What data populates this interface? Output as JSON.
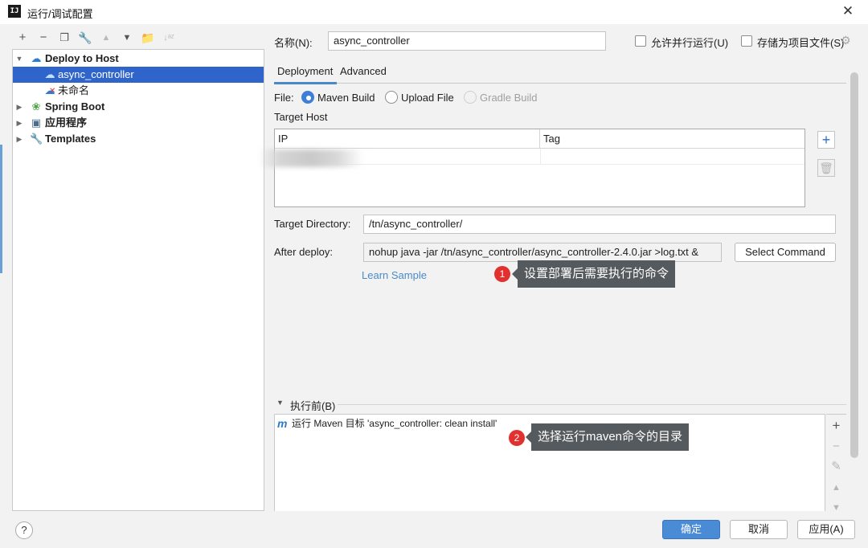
{
  "window": {
    "title": "运行/调试配置",
    "app_icon_text": "IJ"
  },
  "toolbar": {
    "icons": [
      "add-icon",
      "remove-icon",
      "copy-icon",
      "wrench-icon",
      "arrow-up-icon",
      "arrow-down-icon",
      "folder-icon",
      "sort-icon"
    ]
  },
  "tree": {
    "items": [
      {
        "label": "Deploy to Host",
        "icon": "cloud-upload-icon",
        "expanded": true
      },
      {
        "label": "async_controller",
        "icon": "cloud-upload-icon",
        "selected": true
      },
      {
        "label": "未命名",
        "icon": "cloud-upload-error-icon"
      },
      {
        "label": "Spring Boot",
        "icon": "spring-boot-icon",
        "expanded": false
      },
      {
        "label": "应用程序",
        "icon": "application-icon",
        "expanded": false
      },
      {
        "label": "Templates",
        "icon": "wrench-icon",
        "expanded": false
      }
    ]
  },
  "form": {
    "name_label": "名称(N):",
    "name_value": "async_controller",
    "allow_parallel_label": "允许并行运行(U)",
    "store_as_file_label": "存储为项目文件(S)",
    "tabs": [
      "Deployment",
      "Advanced"
    ],
    "file_label": "File:",
    "file_options": [
      {
        "label": "Maven Build",
        "checked": true,
        "disabled": false
      },
      {
        "label": "Upload File",
        "checked": false,
        "disabled": false
      },
      {
        "label": "Gradle Build",
        "checked": false,
        "disabled": true
      }
    ],
    "target_host_label": "Target Host",
    "hosts_table": {
      "columns": [
        "IP",
        "Tag"
      ]
    },
    "target_dir_label": "Target Directory:",
    "target_dir_value": "/tn/async_controller/",
    "after_deploy_label": "After deploy:",
    "after_deploy_value": "nohup java -jar /tn/async_controller/async_controller-2.4.0.jar >log.txt &",
    "select_command_label": "Select Command",
    "learn_sample_label": "Learn Sample"
  },
  "annotations": [
    {
      "number": "1",
      "text": "设置部署后需要执行的命令"
    },
    {
      "number": "2",
      "text": "选择运行maven命令的目录"
    }
  ],
  "before_launch": {
    "header": "执行前(B)",
    "items": [
      {
        "icon": "maven-icon",
        "text": "运行 Maven 目标 'async_controller: clean install'"
      }
    ]
  },
  "footer": {
    "ok_label": "确定",
    "cancel_label": "取消",
    "apply_label": "应用(A)",
    "help_label": "?"
  },
  "colors": {
    "selection": "#2f65ca",
    "primary_button": "#4a8bd6",
    "badge": "#e2302f",
    "tooltip": "#555a5e",
    "link": "#4a8bc9"
  }
}
